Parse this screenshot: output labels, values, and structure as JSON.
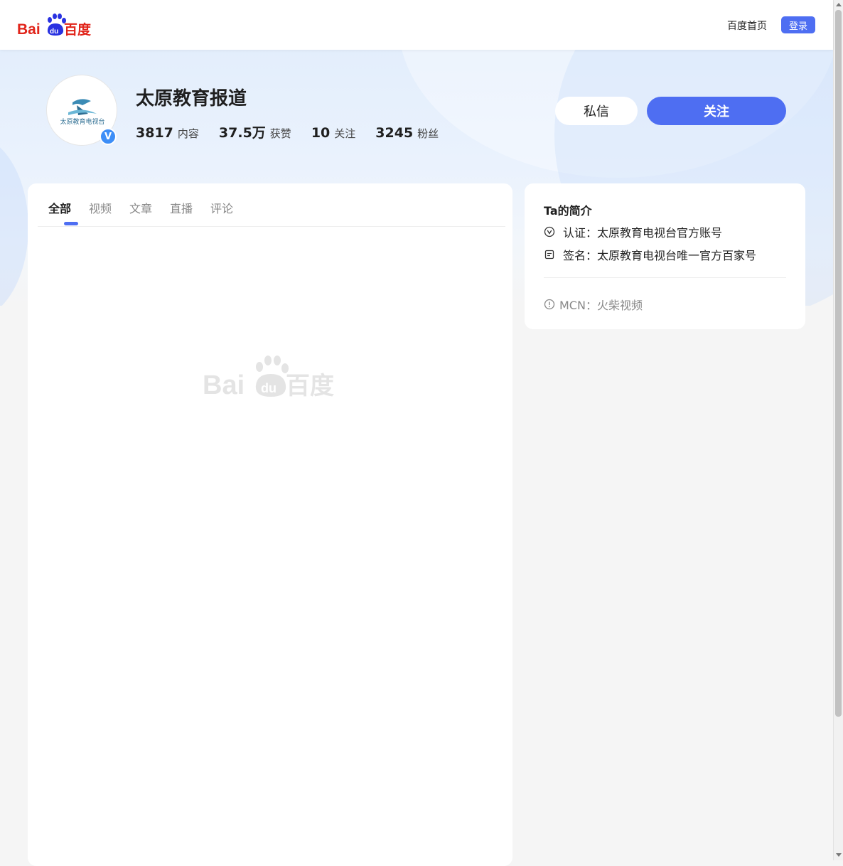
{
  "header": {
    "home_link": "百度首页",
    "login_label": "登录"
  },
  "profile": {
    "name": "太原教育报道",
    "verified_badge": "V",
    "stats": [
      {
        "value": "3817",
        "label": "内容"
      },
      {
        "value": "37.5万",
        "label": "获赞"
      },
      {
        "value": "10",
        "label": "关注"
      },
      {
        "value": "3245",
        "label": "粉丝"
      }
    ],
    "message_label": "私信",
    "follow_label": "关注"
  },
  "tabs": [
    {
      "label": "全部",
      "active": true
    },
    {
      "label": "视频",
      "active": false
    },
    {
      "label": "文章",
      "active": false
    },
    {
      "label": "直播",
      "active": false
    },
    {
      "label": "评论",
      "active": false
    }
  ],
  "intro": {
    "title": "Ta的简介",
    "certification": "认证：太原教育电视台官方账号",
    "signature": "签名：太原教育电视台唯一官方百家号",
    "mcn": "MCN：火柴视频"
  },
  "colors": {
    "accent": "#4e6ef2",
    "baidu_red": "#e1251b",
    "baidu_blue": "#2932e1"
  },
  "icons": {
    "certification": "check-circle-icon",
    "signature": "document-icon",
    "mcn": "info-circle-icon"
  }
}
